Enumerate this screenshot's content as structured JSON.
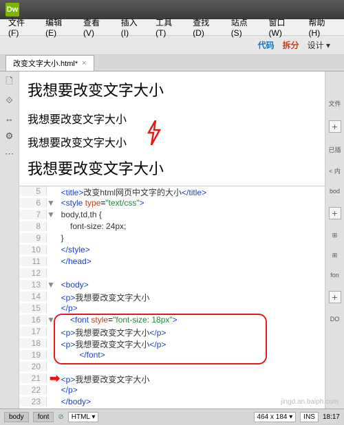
{
  "titlebar": {
    "logo": "Dw"
  },
  "menubar": {
    "items": [
      "文件(F)",
      "编辑(E)",
      "查看(V)",
      "插入(I)",
      "工具(T)",
      "查找(D)",
      "站点(S)",
      "窗口(W)",
      "帮助(H)"
    ]
  },
  "toolbar": {
    "code": "代码",
    "split": "拆分",
    "design": "设计 ▾"
  },
  "tab": {
    "label": "改变文字大小.html*",
    "close": "×"
  },
  "preview": {
    "p1": "我想要改变文字大小",
    "p2": "我想要改变文字大小",
    "p3": "我想要改变文字大小",
    "p4": "我想要改变文字大小"
  },
  "code": {
    "lines": [
      {
        "n": "5",
        "fold": "",
        "html": "  <span class='tag'>&lt;title&gt;</span><span class='txt'>改变html网页中文字的大小</span><span class='tag'>&lt;/title&gt;</span>"
      },
      {
        "n": "6",
        "fold": "▼",
        "html": "  <span class='tag'>&lt;style</span> <span class='attr'>type</span>=<span class='str'>\"text/css\"</span><span class='tag'>&gt;</span>"
      },
      {
        "n": "7",
        "fold": "▼",
        "html": "  <span class='txt'>body,td,th {</span>"
      },
      {
        "n": "8",
        "fold": "",
        "html": "      <span class='txt'>font-size: 24px;</span>"
      },
      {
        "n": "9",
        "fold": "",
        "html": "  <span class='txt'>}</span>"
      },
      {
        "n": "10",
        "fold": "",
        "html": "  <span class='tag'>&lt;/style&gt;</span>"
      },
      {
        "n": "11",
        "fold": "",
        "html": "  <span class='tag'>&lt;/head&gt;</span>"
      },
      {
        "n": "12",
        "fold": "",
        "html": ""
      },
      {
        "n": "13",
        "fold": "▼",
        "html": "  <span class='tag'>&lt;body&gt;</span>"
      },
      {
        "n": "14",
        "fold": "",
        "html": "  <span class='tag'>&lt;p&gt;</span><span class='txt'>我想要改变文字大小</span>"
      },
      {
        "n": "15",
        "fold": "",
        "html": "  <span class='tag'>&lt;/p&gt;</span>"
      },
      {
        "n": "16",
        "fold": "▼",
        "html": "      <span class='tag'>&lt;font</span> <span class='attr'>style</span>=<span class='str'>\"font-size: 18px\"</span><span class='tag'>&gt;</span>"
      },
      {
        "n": "17",
        "fold": "",
        "html": "  <span class='tag'>&lt;p&gt;</span><span class='txt'>我想要改变文字大小</span><span class='tag'>&lt;/p&gt;</span>"
      },
      {
        "n": "18",
        "fold": "",
        "html": "  <span class='tag'>&lt;p&gt;</span><span class='txt'>我想要改变文字大小</span><span class='tag'>&lt;/p&gt;</span>"
      },
      {
        "n": "19",
        "fold": "",
        "html": "          <span class='tag'>&lt;/font&gt;</span>"
      },
      {
        "n": "20",
        "fold": "",
        "html": ""
      },
      {
        "n": "21",
        "fold": "",
        "html": "  <span class='tag'>&lt;p&gt;</span><span class='txt'>我想要改变文字大小</span>"
      },
      {
        "n": "22",
        "fold": "",
        "html": "  <span class='tag'>&lt;/p&gt;</span>"
      },
      {
        "n": "23",
        "fold": "",
        "html": "  <span class='tag'>&lt;/body&gt;</span>"
      }
    ]
  },
  "right": {
    "file": "文件",
    "plus": "+",
    "insert": "已插",
    "n": "< 内",
    "bod": "bod",
    "t": "⊞",
    "f": "⊞",
    "fon": "fon",
    "dom": "DO"
  },
  "status": {
    "bc1": "body",
    "bc2": "font",
    "check": "⊘",
    "lang": "HTML",
    "langarrow": "▾",
    "dims": "464 x 184",
    "dimsarrow": "▾",
    "ins": "INS",
    "time": "18:17"
  },
  "watermark": "jingd.an.baiph.com"
}
